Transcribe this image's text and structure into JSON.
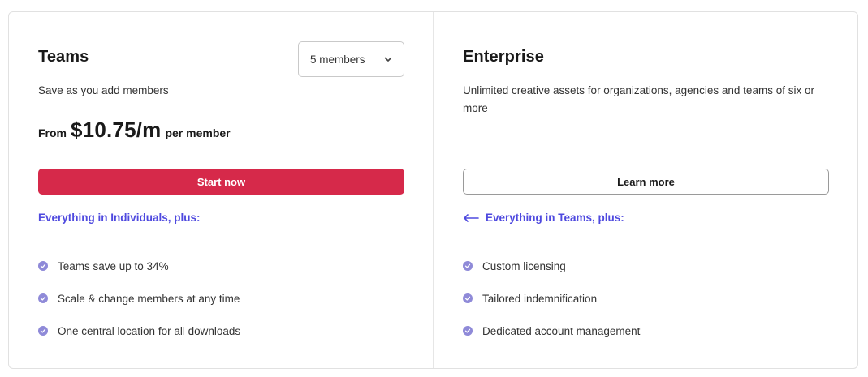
{
  "colors": {
    "primary_button": "#d6294a",
    "link_accent": "#4f4adf",
    "check_badge": "#8f8ad8",
    "border": "#e1e1e1"
  },
  "teams": {
    "title": "Teams",
    "description": "Save as you add members",
    "member_select": {
      "value": "5 members",
      "icon": "chevron-down-icon"
    },
    "price": {
      "prefix": "From",
      "amount": "$10.75/m",
      "suffix": "per member"
    },
    "cta_label": "Start now",
    "includes_label": "Everything in Individuals, plus:",
    "features": [
      "Teams save up to 34%",
      "Scale & change members at any time",
      "One central location for all downloads"
    ]
  },
  "enterprise": {
    "title": "Enterprise",
    "description": "Unlimited creative assets for organizations, agencies and teams of six or more",
    "cta_label": "Learn more",
    "includes_label": "Everything in Teams, plus:",
    "includes_icon": "arrow-left-icon",
    "features": [
      "Custom licensing",
      "Tailored indemnification",
      "Dedicated account management"
    ]
  }
}
